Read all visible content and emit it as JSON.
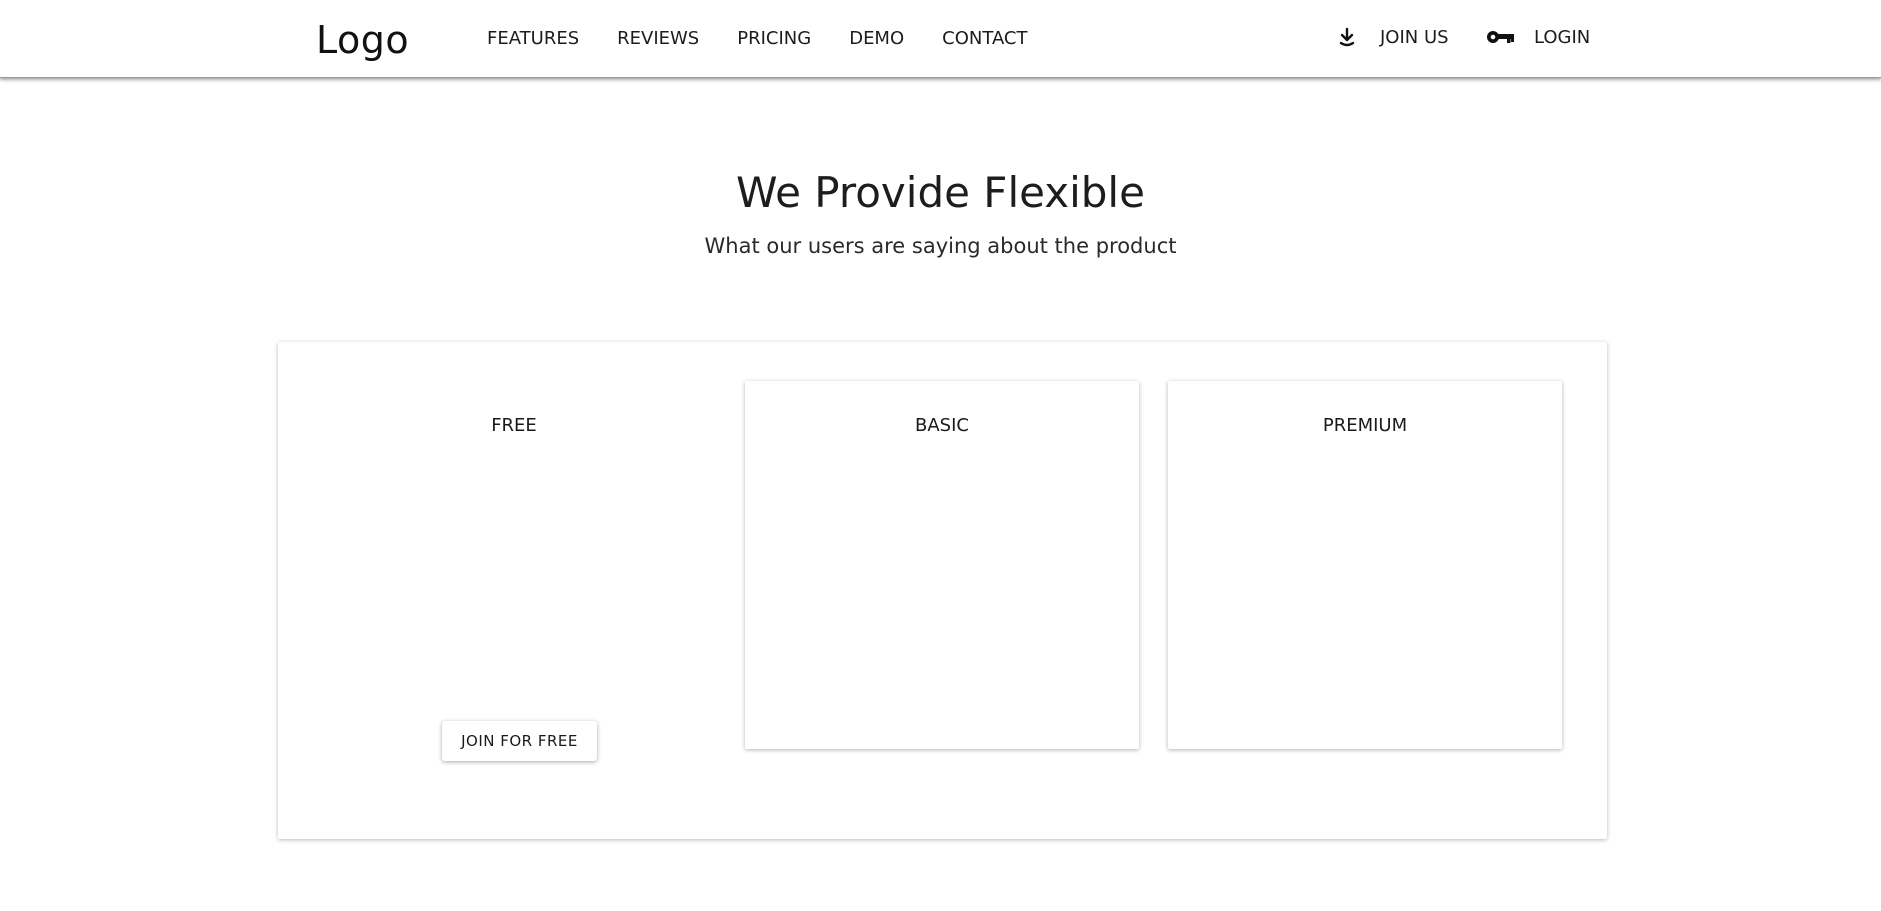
{
  "header": {
    "logo": "Logo",
    "nav": [
      "FEATURES",
      "REVIEWS",
      "PRICING",
      "DEMO",
      "CONTACT"
    ],
    "join_us": "JOIN US",
    "login": "LOGIN",
    "join_icon": "download-icon",
    "login_icon": "key-icon"
  },
  "hero": {
    "title": "We Provide Flexible",
    "subtitle": "What our users are saying about the product"
  },
  "pricing": {
    "plans": [
      {
        "name": "FREE",
        "button": "JOIN FOR FREE"
      },
      {
        "name": "BASIC"
      },
      {
        "name": "PREMIUM"
      }
    ]
  }
}
